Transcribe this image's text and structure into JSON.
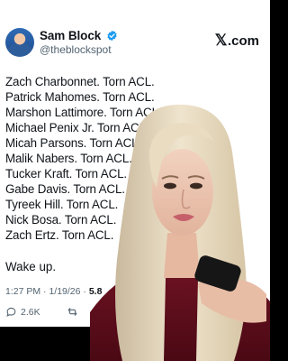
{
  "tweet": {
    "author_name": "Sam Block",
    "author_handle": "@theblockspot",
    "platform_label": ".com",
    "lines": [
      "Zach Charbonnet. Torn ACL.",
      "Patrick Mahomes. Torn ACL.",
      "Marshon Lattimore. Torn ACL.",
      "Michael Penix Jr. Torn ACL.",
      "Micah Parsons. Torn ACL.",
      "Malik Nabers. Torn ACL.",
      "Tucker Kraft. Torn ACL.",
      "Gabe Davis. Torn ACL.",
      "Tyreek Hill. Torn ACL.",
      "Nick Bosa. Torn ACL.",
      "Zach Ertz. Torn ACL."
    ],
    "closing": "Wake up.",
    "time": "1:27 PM",
    "date": "1/19/26",
    "views_partial": "5.8",
    "reply_count": "2.6K",
    "icons": {
      "verified": "verified-badge-icon",
      "x_logo": "x-logo-icon",
      "reply": "reply-icon",
      "repost": "repost-icon"
    }
  },
  "colors": {
    "text": "#0f1419",
    "secondary": "#536471",
    "verified": "#1d9bf0",
    "background": "#ffffff"
  }
}
